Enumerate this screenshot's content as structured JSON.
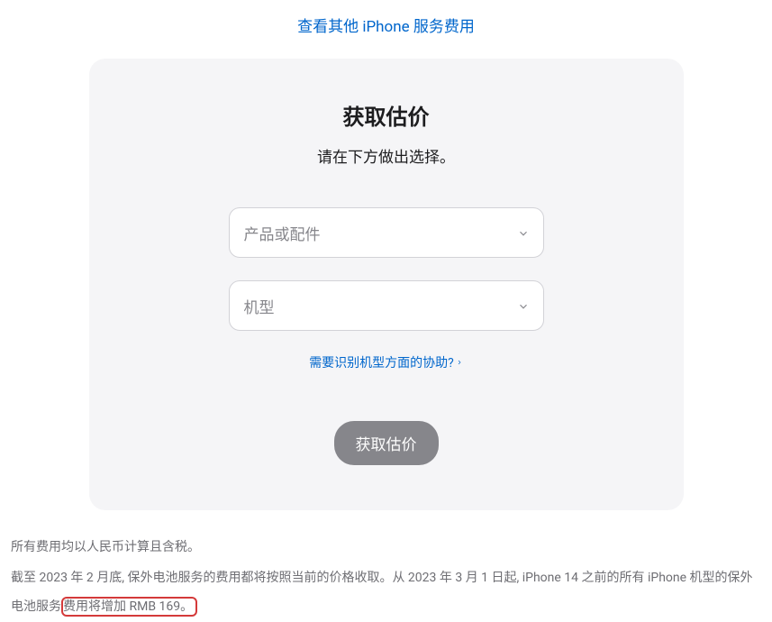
{
  "topLink": "查看其他 iPhone 服务费用",
  "card": {
    "title": "获取估价",
    "subtitle": "请在下方做出选择。",
    "productPlaceholder": "产品或配件",
    "modelPlaceholder": "机型",
    "helpLink": "需要识别机型方面的协助?",
    "button": "获取估价"
  },
  "footer": {
    "line1": "所有费用均以人民币计算且含税。",
    "line2a": "截至 2023 年 2 月底, 保外电池服务的费用都将按照当前的价格收取。从 2023 年 3 月 1 日起, iPhone 14 之前的所有 iPhone 机型的保外电池服务",
    "line2b": "费用将增加 RMB 169。"
  }
}
